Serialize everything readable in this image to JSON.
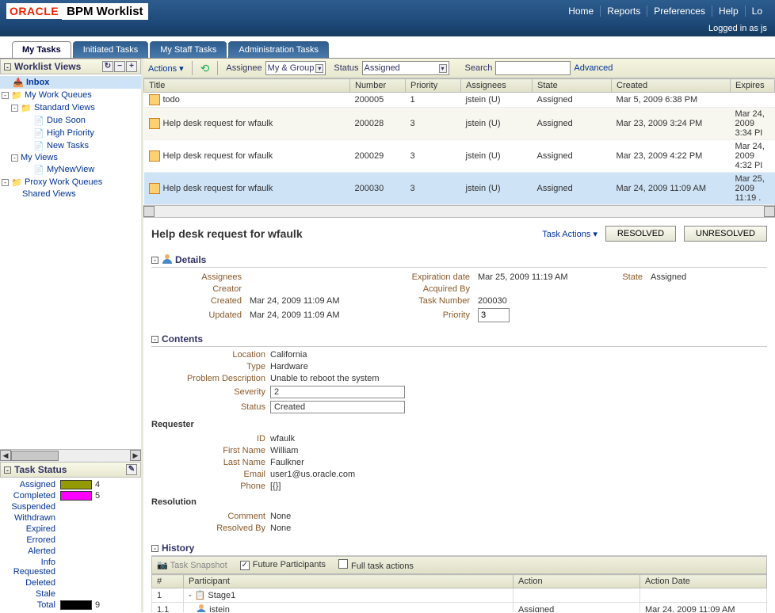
{
  "header": {
    "logo_oracle": "ORACLE",
    "logo_bpm": "BPM Worklist",
    "nav": [
      "Home",
      "Reports",
      "Preferences",
      "Help",
      "Lo"
    ],
    "logged_in": "Logged in as js"
  },
  "tabs": [
    {
      "label": "My Tasks",
      "active": true
    },
    {
      "label": "Initiated Tasks",
      "active": false
    },
    {
      "label": "My Staff Tasks",
      "active": false
    },
    {
      "label": "Administration Tasks",
      "active": false
    }
  ],
  "worklist_views": {
    "title": "Worklist Views",
    "nodes": [
      {
        "label": "Inbox",
        "indent": 0,
        "icon": "📥",
        "selected": true,
        "expander": ""
      },
      {
        "label": "My Work Queues",
        "indent": 0,
        "icon": "📁",
        "expander": "-"
      },
      {
        "label": "Standard Views",
        "indent": 1,
        "icon": "📁",
        "expander": "-"
      },
      {
        "label": "Due Soon",
        "indent": 2,
        "icon": "📄",
        "expander": ""
      },
      {
        "label": "High Priority",
        "indent": 2,
        "icon": "📄",
        "expander": ""
      },
      {
        "label": "New Tasks",
        "indent": 2,
        "icon": "📄",
        "expander": ""
      },
      {
        "label": "My Views",
        "indent": 1,
        "icon": "",
        "expander": "-"
      },
      {
        "label": "MyNewView",
        "indent": 2,
        "icon": "📄",
        "expander": ""
      },
      {
        "label": "Proxy Work Queues",
        "indent": 0,
        "icon": "📁",
        "expander": "-"
      },
      {
        "label": "Shared Views",
        "indent": 1,
        "icon": "",
        "expander": ""
      }
    ]
  },
  "task_status": {
    "title": "Task Status",
    "rows": [
      {
        "label": "Assigned",
        "count": "4",
        "color": "#939b00"
      },
      {
        "label": "Completed",
        "count": "5",
        "color": "#ff00ff"
      },
      {
        "label": "Suspended",
        "count": ""
      },
      {
        "label": "Withdrawn",
        "count": ""
      },
      {
        "label": "Expired",
        "count": ""
      },
      {
        "label": "Errored",
        "count": ""
      },
      {
        "label": "Alerted",
        "count": ""
      },
      {
        "label": "Info Requested",
        "count": ""
      },
      {
        "label": "Deleted",
        "count": ""
      },
      {
        "label": "Stale",
        "count": ""
      },
      {
        "label": "Total",
        "count": "9",
        "color": "#000"
      }
    ]
  },
  "toolbar": {
    "actions_label": "Actions",
    "assignee_label": "Assignee",
    "assignee_value": "My & Group",
    "status_label": "Status",
    "status_value": "Assigned",
    "search_label": "Search",
    "advanced_label": "Advanced"
  },
  "task_table": {
    "columns": [
      "Title",
      "Number",
      "Priority",
      "Assignees",
      "State",
      "Created",
      "Expires"
    ],
    "rows": [
      {
        "title": "todo",
        "number": "200005",
        "priority": "1",
        "assignees": "jstein (U)",
        "state": "Assigned",
        "created": "Mar 5, 2009 6:38 PM",
        "expires": ""
      },
      {
        "title": "Help desk request for wfaulk",
        "number": "200028",
        "priority": "3",
        "assignees": "jstein (U)",
        "state": "Assigned",
        "created": "Mar 23, 2009 3:24 PM",
        "expires": "Mar 24, 2009 3:34 PI",
        "alt": true
      },
      {
        "title": "Help desk request for wfaulk",
        "number": "200029",
        "priority": "3",
        "assignees": "jstein (U)",
        "state": "Assigned",
        "created": "Mar 23, 2009 4:22 PM",
        "expires": "Mar 24, 2009 4:32 PI"
      },
      {
        "title": "Help desk request for wfaulk",
        "number": "200030",
        "priority": "3",
        "assignees": "jstein (U)",
        "state": "Assigned",
        "created": "Mar 24, 2009 11:09 AM",
        "expires": "Mar 25, 2009 11:19 .",
        "selected": true
      }
    ]
  },
  "detail": {
    "title": "Help desk request for wfaulk",
    "task_actions_label": "Task Actions",
    "resolved_btn": "RESOLVED",
    "unresolved_btn": "UNRESOLVED",
    "details_section": "Details",
    "fields": {
      "assignees_lbl": "Assignees",
      "assignees_val": "",
      "creator_lbl": "Creator",
      "creator_val": "",
      "created_lbl": "Created",
      "created_val": "Mar 24, 2009 11:09 AM",
      "updated_lbl": "Updated",
      "updated_val": "Mar 24, 2009 11:09 AM",
      "expiration_lbl": "Expiration date",
      "expiration_val": "Mar 25, 2009 11:19 AM",
      "acquired_lbl": "Acquired By",
      "acquired_val": "",
      "tasknum_lbl": "Task Number",
      "tasknum_val": "200030",
      "priority_lbl": "Priority",
      "priority_val": "3",
      "state_lbl": "State",
      "state_val": "Assigned"
    },
    "contents_section": "Contents",
    "contents": {
      "location_lbl": "Location",
      "location_val": "California",
      "type_lbl": "Type",
      "type_val": "Hardware",
      "problem_lbl": "Problem Description",
      "problem_val": "Unable to reboot the system",
      "severity_lbl": "Severity",
      "severity_val": "2",
      "status_lbl": "Status",
      "status_val": "Created"
    },
    "requester_section": "Requester",
    "requester": {
      "id_lbl": "ID",
      "id_val": "wfaulk",
      "first_lbl": "First Name",
      "first_val": "William",
      "last_lbl": "Last Name",
      "last_val": "Faulkner",
      "email_lbl": "Email",
      "email_val": "user1@us.oracle.com",
      "phone_lbl": "Phone",
      "phone_val": "[{}]"
    },
    "resolution_section": "Resolution",
    "resolution": {
      "comment_lbl": "Comment",
      "comment_val": "None",
      "resolved_lbl": "Resolved By",
      "resolved_val": "None"
    },
    "history_section": "History",
    "history": {
      "snapshot_label": "Task Snapshot",
      "future_label": "Future Participants",
      "fullactions_label": "Full task actions",
      "columns": [
        "#",
        "Participant",
        "Action",
        "Action Date"
      ],
      "rows": [
        {
          "num": "1",
          "participant": "Stage1",
          "action": "",
          "date": "",
          "stage": true
        },
        {
          "num": "1.1",
          "participant": "jstein",
          "action": "Assigned",
          "date": "Mar 24, 2009 11:09 AM"
        }
      ]
    }
  }
}
